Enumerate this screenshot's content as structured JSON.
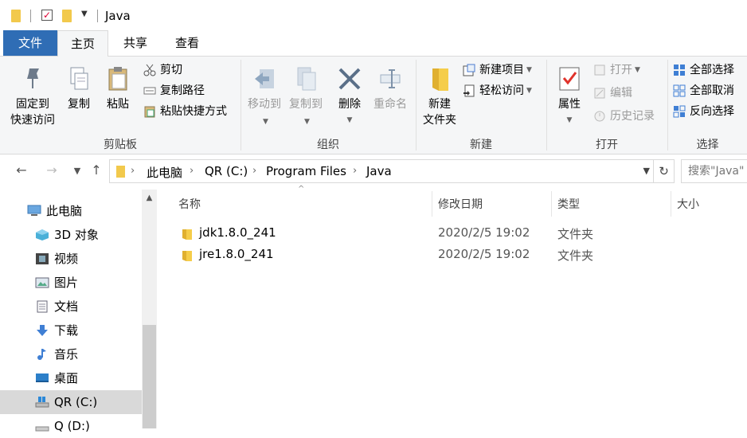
{
  "window": {
    "title": "Java"
  },
  "ribbon_tabs": [
    "文件",
    "主页",
    "共享",
    "查看"
  ],
  "ribbon": {
    "clipboard": {
      "label": "剪贴板",
      "pin_line1": "固定到",
      "pin_line2": "快速访问",
      "copy": "复制",
      "paste": "粘贴",
      "cut": "剪切",
      "copy_path": "复制路径",
      "paste_shortcut": "粘贴快捷方式"
    },
    "organize": {
      "label": "组织",
      "move_to": "移动到",
      "copy_to": "复制到",
      "delete": "删除",
      "rename": "重命名"
    },
    "new": {
      "label": "新建",
      "new_folder_line1": "新建",
      "new_folder_line2": "文件夹",
      "new_item": "新建项目",
      "easy_access": "轻松访问"
    },
    "open": {
      "label": "打开",
      "properties": "属性",
      "open": "打开",
      "edit": "编辑",
      "history": "历史记录"
    },
    "select": {
      "label": "选择",
      "select_all": "全部选择",
      "select_none": "全部取消",
      "invert": "反向选择"
    }
  },
  "address": {
    "crumbs": [
      "此电脑",
      "QR (C:)",
      "Program Files",
      "Java"
    ],
    "search_placeholder": "搜索\"Java\""
  },
  "nav_pane": {
    "items": [
      "此电脑",
      "3D 对象",
      "视频",
      "图片",
      "文档",
      "下载",
      "音乐",
      "桌面",
      "QR (C:)",
      "Q (D:)"
    ]
  },
  "columns": [
    "名称",
    "修改日期",
    "类型",
    "大小"
  ],
  "files": [
    {
      "name": "jdk1.8.0_241",
      "modified": "2020/2/5 19:02",
      "type": "文件夹",
      "size": ""
    },
    {
      "name": "jre1.8.0_241",
      "modified": "2020/2/5 19:02",
      "type": "文件夹",
      "size": ""
    }
  ],
  "colors": {
    "accent": "#2f6db5",
    "folder": "#f2c94c",
    "selected": "#d9d9d9"
  }
}
